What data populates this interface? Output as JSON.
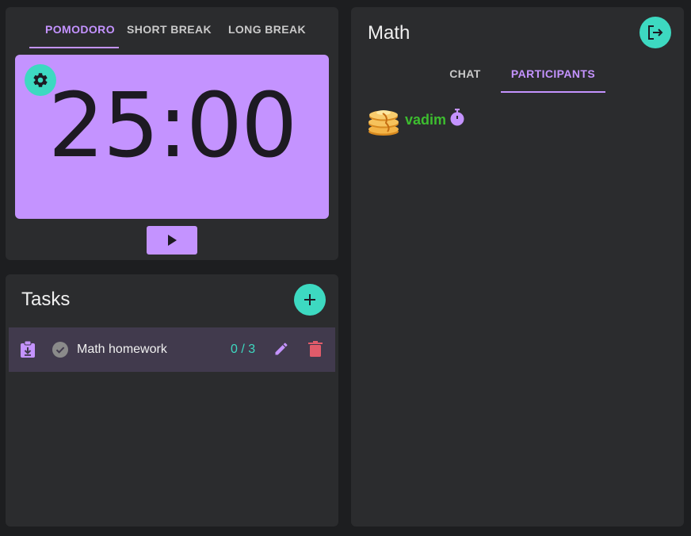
{
  "timer": {
    "tabs": [
      {
        "label": "POMODORO",
        "active": true
      },
      {
        "label": "SHORT BREAK",
        "active": false
      },
      {
        "label": "LONG BREAK",
        "active": false
      }
    ],
    "display": "25:00",
    "settings_icon": "gear-icon",
    "play_icon": "play-icon"
  },
  "tasks": {
    "title": "Tasks",
    "add_icon": "plus-icon",
    "items": [
      {
        "name": "Math homework",
        "count": "0 / 3",
        "done": false
      }
    ]
  },
  "room": {
    "title": "Math",
    "leave_icon": "logout-icon",
    "tabs": [
      {
        "label": "CHAT",
        "active": false
      },
      {
        "label": "PARTICIPANTS",
        "active": true
      }
    ],
    "participants": [
      {
        "name": "vadim",
        "avatar": "pancakes-emoji",
        "status_icon": "stopwatch-icon"
      }
    ]
  },
  "colors": {
    "accent_purple": "#c493ff",
    "accent_teal": "#3dd9c1",
    "panel_bg": "#2b2c2e",
    "page_bg": "#1d1e20",
    "participant_name": "#3dbd2f",
    "delete_red": "#e05b6a"
  }
}
